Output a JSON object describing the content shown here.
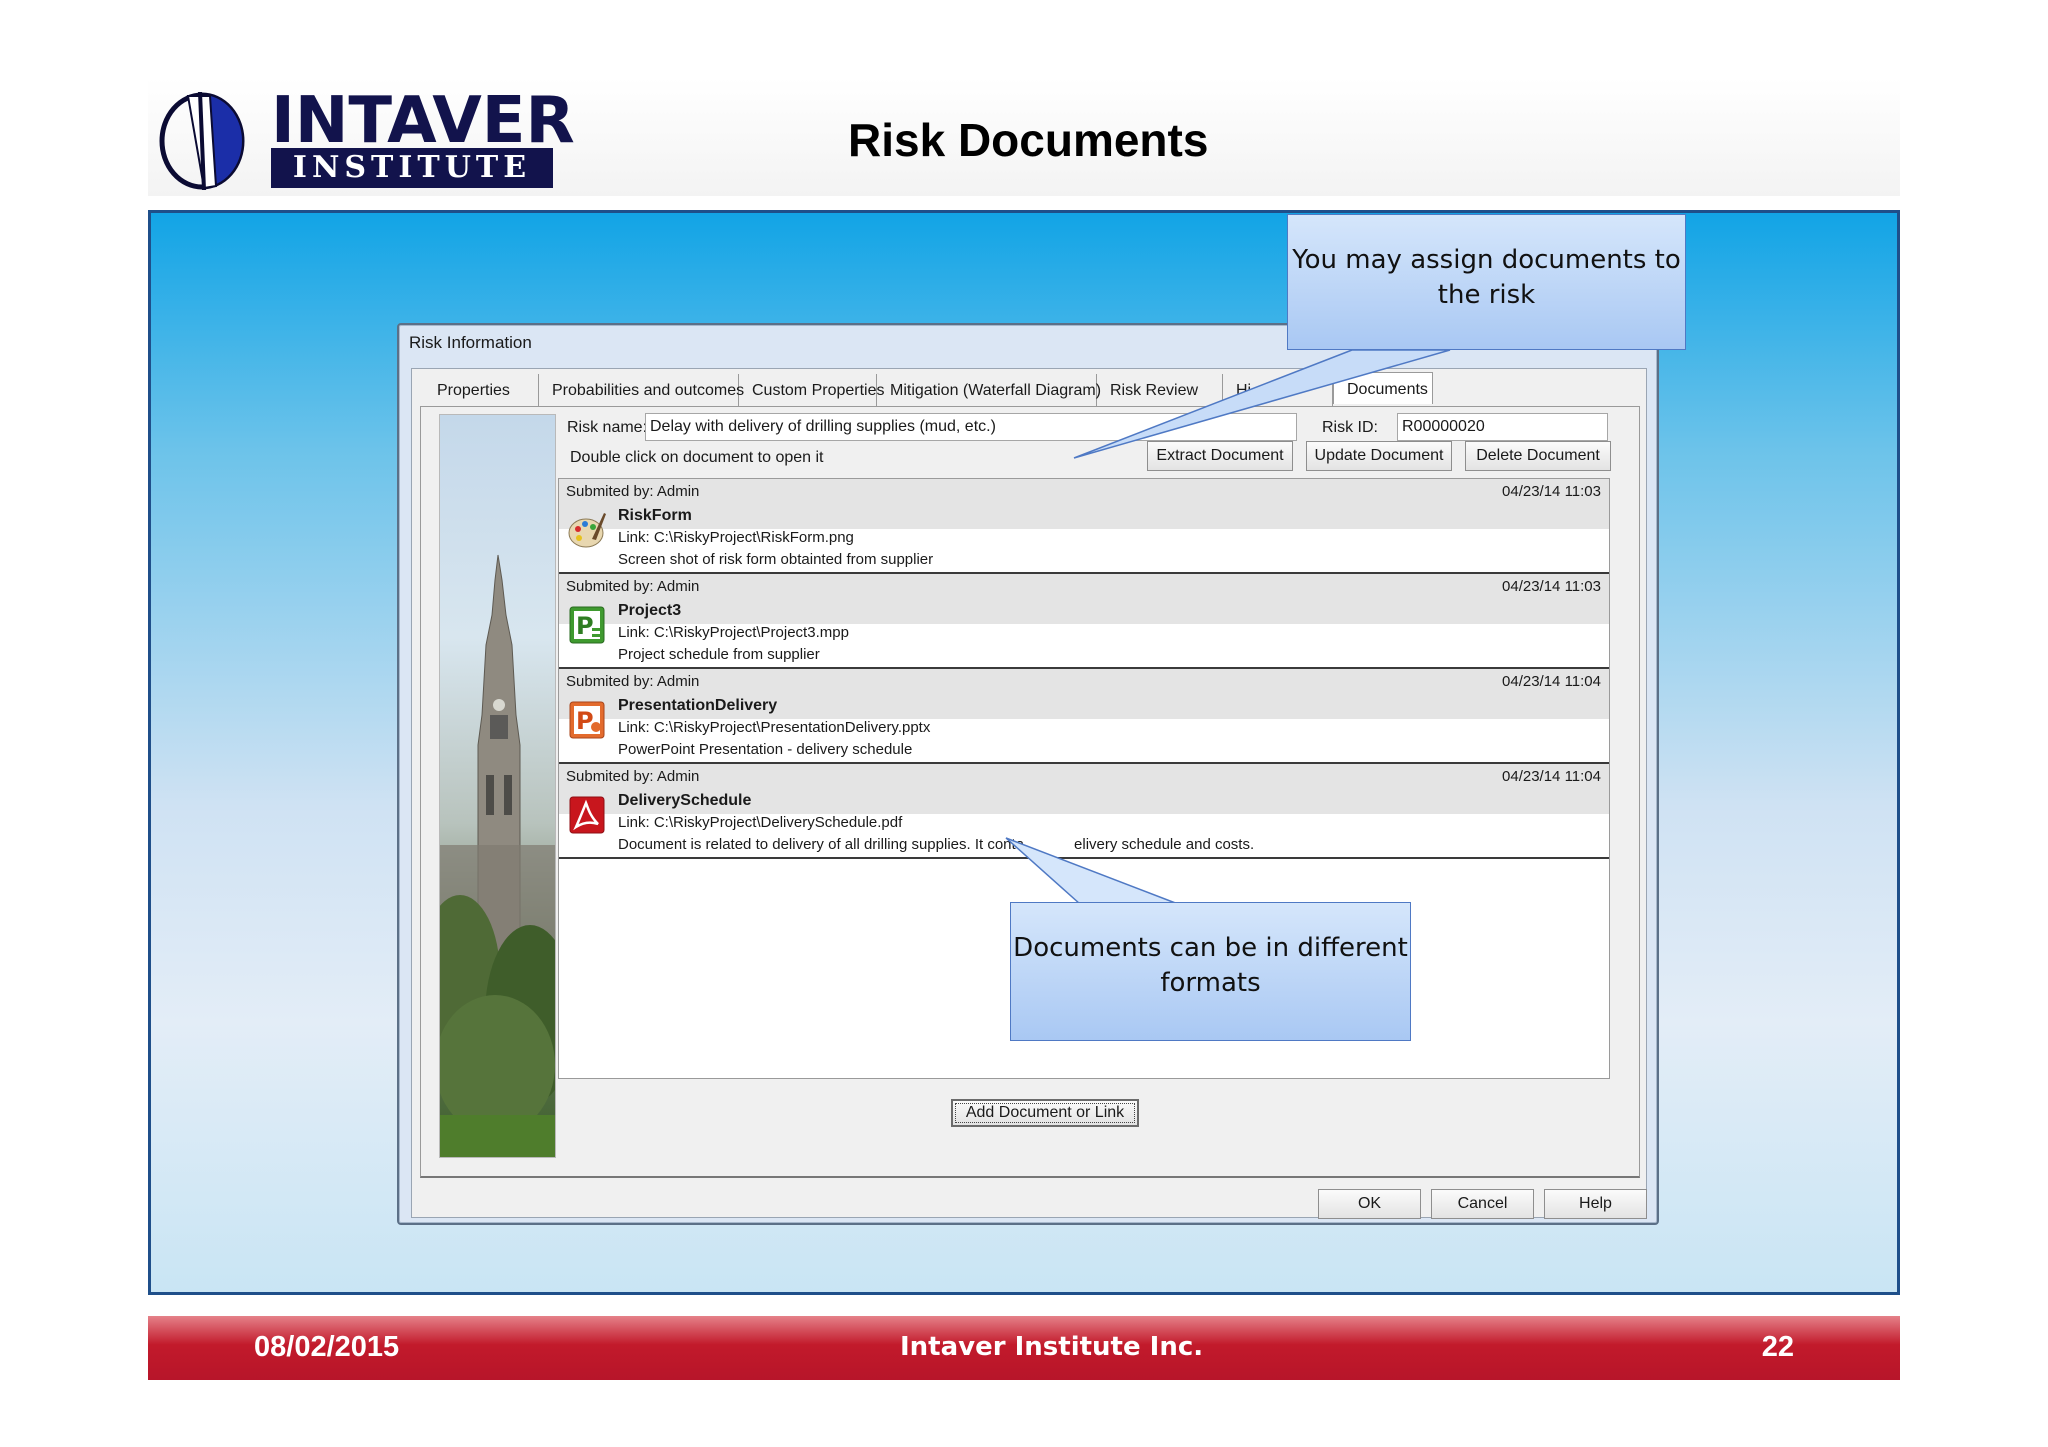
{
  "slide": {
    "title": "Risk Documents",
    "logo_top": "INTAVER",
    "logo_bottom": "INSTITUTE"
  },
  "dialog": {
    "title": "Risk Information",
    "tabs": [
      {
        "label": "Properties"
      },
      {
        "label": "Probabilities and outcomes"
      },
      {
        "label": "Custom Properties"
      },
      {
        "label": "Mitigation (Waterfall Diagram)"
      },
      {
        "label": "Risk Review"
      },
      {
        "label": "Hi"
      },
      {
        "label": "Documents"
      }
    ],
    "risk_name_label": "Risk name:",
    "risk_name_value": "Delay with delivery of drilling supplies (mud, etc.)",
    "risk_id_label": "Risk ID:",
    "risk_id_value": "R00000020",
    "hint": "Double click on document to open it",
    "buttons": {
      "extract": "Extract Document",
      "update": "Update Document",
      "delete": "Delete Document",
      "add": "Add Document or Link",
      "ok": "OK",
      "cancel": "Cancel",
      "help": "Help"
    },
    "documents": [
      {
        "submitted": "Submited by: Admin",
        "date": "04/23/14 11:03",
        "name": "RiskForm",
        "link": "Link: C:\\RiskyProject\\RiskForm.png",
        "description": "Screen shot of risk form obtainted from supplier",
        "icon": "paint-icon"
      },
      {
        "submitted": "Submited by: Admin",
        "date": "04/23/14 11:03",
        "name": "Project3",
        "link": "Link: C:\\RiskyProject\\Project3.mpp",
        "description": "Project schedule from supplier",
        "icon": "project-icon"
      },
      {
        "submitted": "Submited by: Admin",
        "date": "04/23/14 11:04",
        "name": "PresentationDelivery",
        "link": "Link: C:\\RiskyProject\\PresentationDelivery.pptx",
        "description": "PowerPoint Presentation - delivery schedule",
        "icon": "powerpoint-icon"
      },
      {
        "submitted": "Submited by: Admin",
        "date": "04/23/14 11:04",
        "name": "DeliverySchedule",
        "link": "Link: C:\\RiskyProject\\DeliverySchedule.pdf",
        "description": "Document is related to delivery of all drilling supplies. It conta",
        "description_tail": "elivery schedule and costs.",
        "icon": "pdf-icon"
      }
    ]
  },
  "callouts": {
    "top": "You may assign documents to the risk",
    "bottom": "Documents can be in different formats"
  },
  "footer": {
    "date": "08/02/2015",
    "company": "Intaver Institute Inc.",
    "page": "22"
  },
  "colors": {
    "footer_red": "#c21a2b",
    "logo_navy": "#12134c",
    "panel_blue": "#12a4e6"
  }
}
